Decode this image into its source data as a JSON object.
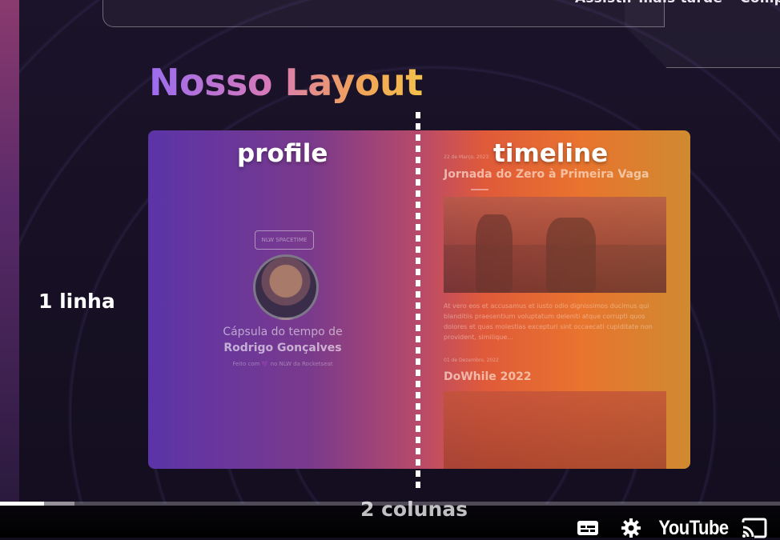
{
  "top_bar": {
    "watch_later": "Assistir mais tarde",
    "share": "Compartilhar"
  },
  "slide": {
    "title": "Nosso Layout",
    "profile_label": "profile",
    "timeline_label": "timeline",
    "row_label": "1 linha",
    "columns_label": "2 colunas",
    "profile": {
      "logo": "NLW SPACETIME",
      "capsule_line1": "Cápsula do tempo de",
      "capsule_line2": "Rodrigo Gonçalves",
      "credit": "Feito com 💜 no NLW da Rocketseat"
    },
    "timeline": {
      "post1_date": "22 de Março, 2023",
      "post1_title": "Jornada do Zero à Primeira Vaga",
      "post1_body": "At vero eos et accusamus et iusto odio dignissimos ducimus qui blanditiis praesentium voluptatum deleniti atque corrupti quos dolores et quas molestias excepturi sint occaecati cupiditate non provident, similique...",
      "post2_date": "01 de Dezembro, 2022",
      "post2_title": "DoWhile 2022"
    }
  },
  "player": {
    "progress_played": 0.056,
    "progress_loaded": 0.095,
    "logo": "YouTube",
    "icons": [
      "subtitles-icon",
      "settings-gear-icon",
      "youtube-logo",
      "cast-icon"
    ]
  },
  "colors": {
    "title_gradient": [
      "#9b6cf0",
      "#d87ab8",
      "#f0a15a",
      "#f4c04a"
    ],
    "box_gradient": [
      "#5b34a8",
      "#b84a6a",
      "#e8742e",
      "#d08a30"
    ]
  }
}
